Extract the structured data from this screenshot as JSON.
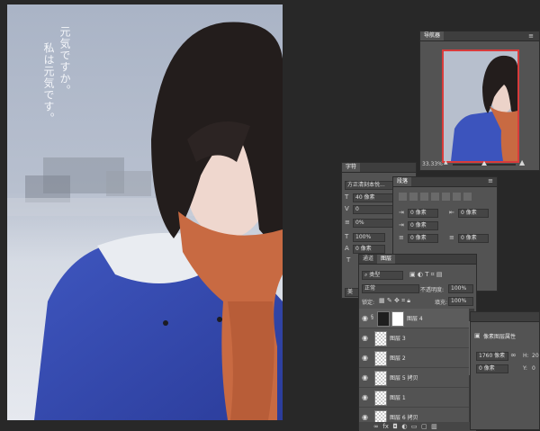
{
  "canvas": {
    "text_col1": "元気ですか。",
    "text_col2": "私は元気です。"
  },
  "navigator": {
    "title": "导航器",
    "zoom": "33.33%"
  },
  "character": {
    "title": "字符",
    "font_family": "方正清刻本悦...",
    "font_size": "40 像素",
    "kerning": "0",
    "tracking": "0%",
    "vertical_scale": "100%",
    "baseline": "0 像素",
    "lang": "美"
  },
  "paragraph": {
    "title": "段落",
    "indent1": "0 像素",
    "indent2": "0 像素",
    "indent3": "0 像素",
    "space": "0 像素",
    "space2": "0 像素"
  },
  "layers": {
    "tab_channels": "通道",
    "tab_layers": "图层",
    "filter_kind": "类型",
    "blend_mode": "正常",
    "opacity_label": "不透明度:",
    "opacity": "100%",
    "lock_label": "锁定:",
    "fill_label": "填充:",
    "fill": "100%",
    "items": [
      {
        "name": "图层 4"
      },
      {
        "name": "图层 3"
      },
      {
        "name": "图层 2"
      },
      {
        "name": "图层 5 拷贝"
      },
      {
        "name": "图层 1"
      },
      {
        "name": "图层 6 拷贝"
      }
    ]
  },
  "properties": {
    "title": "像素图层属性",
    "width": "1760 像素",
    "x": "0 像素",
    "h_label": "H:",
    "y_label": "Y:",
    "h": "20",
    "y": "0"
  }
}
